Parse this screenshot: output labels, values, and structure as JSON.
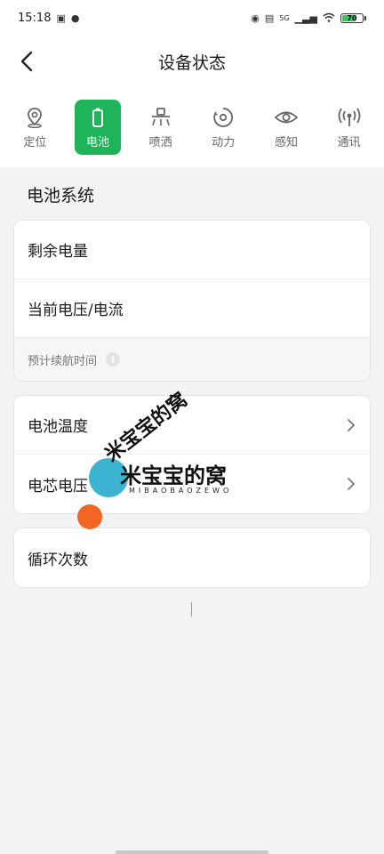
{
  "status_bar": {
    "time": "15:18",
    "network": "5G",
    "battery": "70",
    "battery_level": 0.7
  },
  "nav": {
    "title": "设备状态"
  },
  "tabs": [
    {
      "label": "定位",
      "icon": "location-pin-icon"
    },
    {
      "label": "电池",
      "icon": "battery-icon",
      "active": true
    },
    {
      "label": "喷洒",
      "icon": "sprayer-icon"
    },
    {
      "label": "动力",
      "icon": "motor-icon"
    },
    {
      "label": "感知",
      "icon": "eye-icon"
    },
    {
      "label": "通讯",
      "icon": "signal-icon"
    }
  ],
  "section": {
    "title": "电池系统"
  },
  "card1": {
    "rows": [
      "剩余电量",
      "当前电压/电流"
    ],
    "footer": "预计续航时间"
  },
  "card2": {
    "rows": [
      "电池温度",
      "电芯电压"
    ]
  },
  "card3": {
    "rows": [
      "循环次数"
    ]
  },
  "watermark": {
    "text": "米宝宝的窝",
    "sub": "MIBAOBAOZEWO"
  },
  "colors": {
    "accent": "#1fb35a",
    "background": "#f2f3f5"
  }
}
